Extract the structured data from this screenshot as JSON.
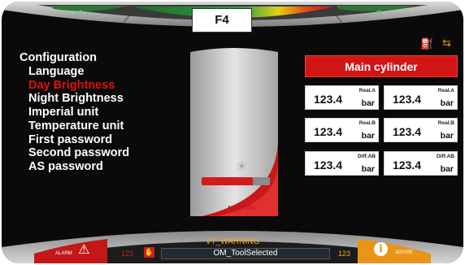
{
  "header": {
    "function_key": "F4",
    "icons": [
      "arrow-left-icon",
      "tilt-icon",
      "tilt-right-icon",
      "arrow-right-icon",
      "fuel-icon",
      "hydraulic-icon"
    ]
  },
  "menu": {
    "title": "Configuration",
    "items": [
      {
        "label": "Language",
        "active": false
      },
      {
        "label": "Day Brightness",
        "active": true
      },
      {
        "label": "Night Brightness",
        "active": false
      },
      {
        "label": "Imperial unit",
        "active": false
      },
      {
        "label": "Temperature unit",
        "active": false
      },
      {
        "label": "First password",
        "active": false
      },
      {
        "label": "Second password",
        "active": false
      },
      {
        "label": "AS password",
        "active": false
      }
    ]
  },
  "brightness": {
    "level_fraction": 0.75,
    "brand": "MANITOU"
  },
  "cylinder": {
    "title": "Main cylinder",
    "readings": [
      {
        "value": "123.4",
        "tag": "Real.A",
        "unit": "bar"
      },
      {
        "value": "123.4",
        "tag": "Real.A",
        "unit": "bar"
      },
      {
        "value": "123.4",
        "tag": "Real.B",
        "unit": "bar"
      },
      {
        "value": "123.4",
        "tag": "Real.B",
        "unit": "bar"
      },
      {
        "value": "123.4",
        "tag": "Diff.AB",
        "unit": "bar"
      },
      {
        "value": "123.4",
        "tag": "Diff.AB",
        "unit": "bar"
      }
    ]
  },
  "status": {
    "warning_title": "VT_WARNING",
    "message": "OM_ToolSelected",
    "left_count": "123",
    "right_count": "123",
    "alarm_label": "ALARM",
    "advise_label": "ADVISE",
    "advise_symbol": "i"
  },
  "colors": {
    "accent_red": "#d21616",
    "warning_orange": "#f2a81d",
    "gauge_green": "#2a9a3a"
  }
}
